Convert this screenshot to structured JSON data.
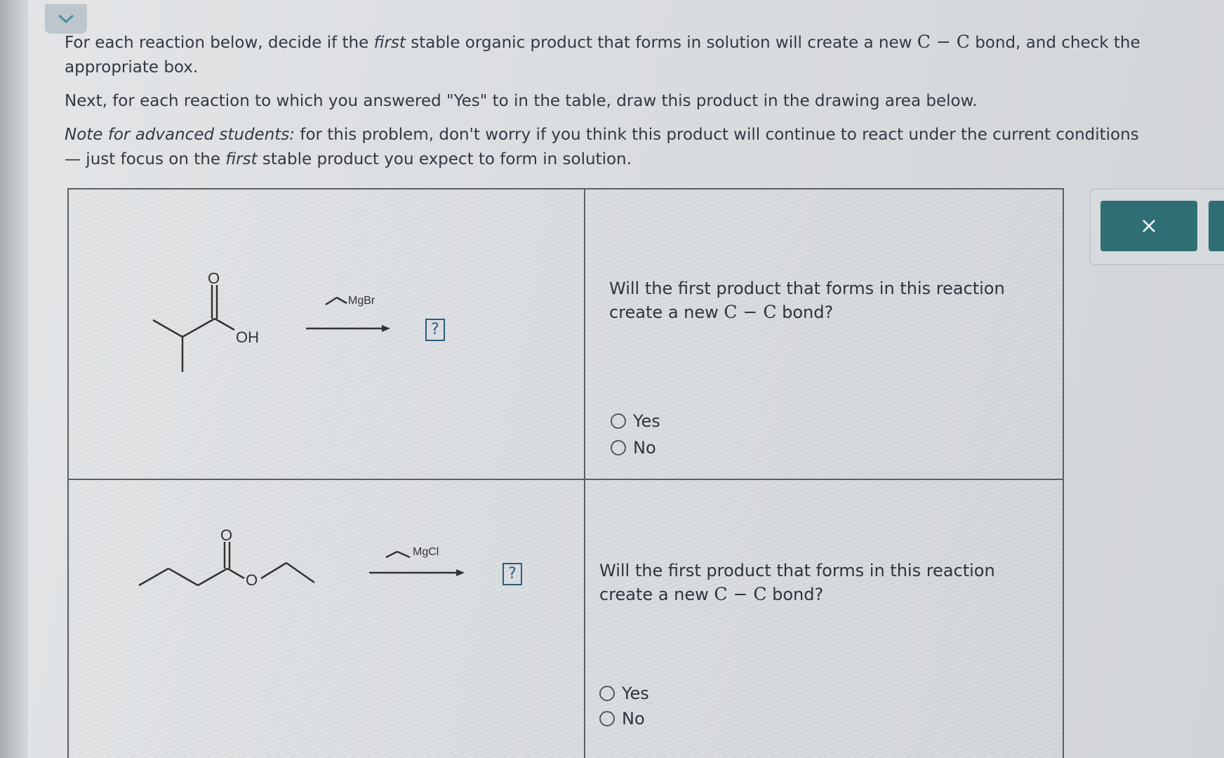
{
  "instructions": {
    "p1_a": "For each reaction below, decide if the ",
    "p1_em": "first",
    "p1_b": " stable organic product that forms in solution will create a new ",
    "p1_cc": "C − C",
    "p1_c": " bond, and check the appropriate box.",
    "p2": "Next, for each reaction to which you answered \"Yes\" to in the table, draw this product in the drawing area below.",
    "p3_em": "Note for advanced students:",
    "p3_a": " for this problem, don't worry if you think this product will continue to react under the current conditions — just focus on the ",
    "p3_em2": "first",
    "p3_b": " stable product you expect to form in solution."
  },
  "reactions": [
    {
      "reactant_atoms": {
        "carbonyl_o": "O",
        "hydroxyl": "OH"
      },
      "reagent": "MgBr",
      "product_placeholder": "?",
      "question_a": "Will the first product that forms in this reaction create a new ",
      "question_cc": "C − C",
      "question_b": " bond?",
      "options": [
        "Yes",
        "No"
      ]
    },
    {
      "reactant_atoms": {
        "carbonyl_o": "O",
        "ester_o": "O"
      },
      "reagent": "MgCl",
      "product_placeholder": "?",
      "question_a": "Will the first product that forms in this reaction create a new ",
      "question_cc": "C − C",
      "question_b": " bond?",
      "options": [
        "Yes",
        "No"
      ]
    }
  ],
  "icons": {
    "collapse": "chevron-down-icon",
    "close": "close-icon"
  },
  "colors": {
    "accent": "#2f6f74",
    "placeholder_border": "#2a5d7d"
  }
}
